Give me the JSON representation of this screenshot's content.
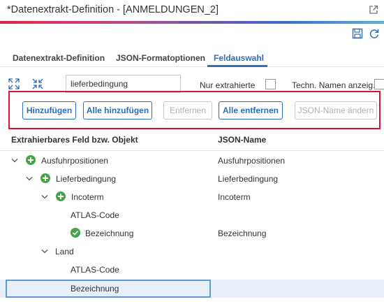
{
  "window": {
    "title": "*Datenextrakt-Definition - [ANMELDUNGEN_2]"
  },
  "icons": {
    "popout": "popout-icon",
    "save": "save-icon",
    "refresh": "refresh-icon",
    "expand_all": "expand-all-icon",
    "collapse_all": "collapse-all-icon"
  },
  "colors": {
    "accent": "#2a6fb8",
    "highlight_box": "#d6133a",
    "success": "#46a34a"
  },
  "tabs": [
    {
      "label": "Datenextrakt-Definition"
    },
    {
      "label": "JSON-Formatoptionen"
    },
    {
      "label": "Feldauswahl"
    }
  ],
  "active_tab": "Feldauswahl",
  "filter": {
    "value": "lieferbedingung",
    "only_extracted_label": "Nur extrahierte",
    "tech_names_label": "Techn. Namen anzeig."
  },
  "buttons": {
    "add": "Hinzufügen",
    "add_all": "Alle hinzufügen",
    "remove": "Entfernen",
    "remove_all": "Alle entfernen",
    "change_json_name": "JSON-Name ändern"
  },
  "grid": {
    "col1": "Extrahierbares Feld bzw. Objekt",
    "col2": "JSON-Name",
    "rows": [
      {
        "label": "Ausfuhrpositionen",
        "json": "Ausfuhrpositionen"
      },
      {
        "label": "Lieferbedingung",
        "json": "Lieferbedingung"
      },
      {
        "label": "Incoterm",
        "json": "Incoterm"
      },
      {
        "label": "ATLAS-Code",
        "json": ""
      },
      {
        "label": "Bezeichnung",
        "json": "Bezeichnung"
      },
      {
        "label": "Land",
        "json": ""
      },
      {
        "label": "ATLAS-Code",
        "json": ""
      },
      {
        "label": "Bezeichnung",
        "json": ""
      }
    ]
  }
}
